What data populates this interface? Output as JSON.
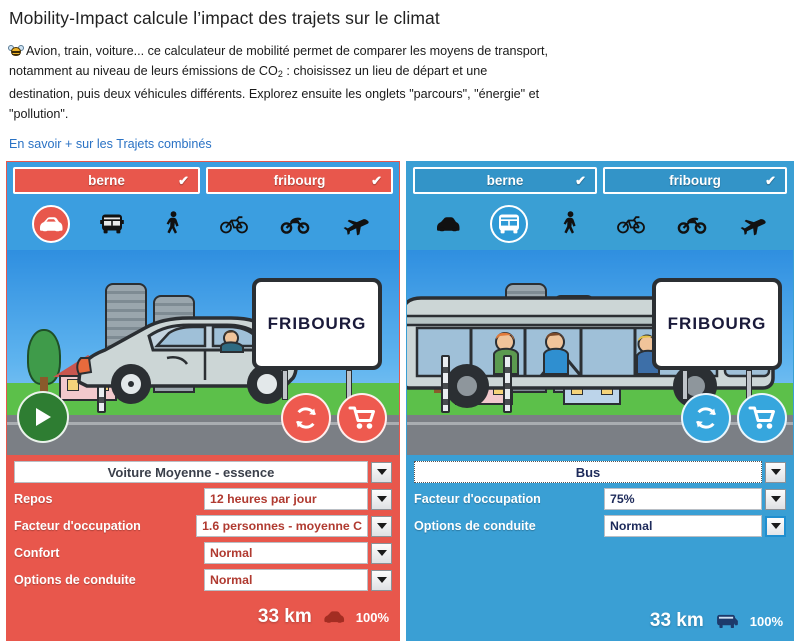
{
  "header": {
    "title": "Mobility-Impact calcule l’impact des trajets sur le climat",
    "bee_icon": "bee-icon",
    "intro_part1": "Avion, train, voiture... ce calculateur de mobilité permet de comparer les moyens de transport, notamment au niveau de leurs émissions de CO",
    "intro_sub": "2",
    "intro_part2": " : choisissez un lieu de départ et une destination, puis deux véhicules différents. Explorez ensuite les onglets \"parcours\", \"énergie\" et \"pollution\".",
    "link": "En savoir + sur les Trajets combinés"
  },
  "colors": {
    "red_accent": "#e8574c",
    "blue_accent": "#3a9fd4",
    "sky_blue": "#3b9ee0",
    "play_green": "#2e7d32",
    "link_blue": "#2a72c4"
  },
  "modes": [
    {
      "name": "car",
      "icon": "car-icon"
    },
    {
      "name": "bus",
      "icon": "bus-icon"
    },
    {
      "name": "pedestrian",
      "icon": "pedestrian-icon"
    },
    {
      "name": "bicycle",
      "icon": "bicycle-icon"
    },
    {
      "name": "motorcycle",
      "icon": "motorcycle-icon"
    },
    {
      "name": "airplane",
      "icon": "airplane-icon"
    }
  ],
  "left": {
    "origin": "berne",
    "destination": "fribourg",
    "origin_check": "✔",
    "destination_check": "✔",
    "selected_mode": "car",
    "sign_label": "FRIBOURG",
    "play_icon": "play-icon",
    "refresh_icon": "refresh-icon",
    "cart_icon": "cart-icon",
    "vehicle": "Voiture Moyenne - essence",
    "fields": [
      {
        "label": "Repos",
        "value": "12 heures par jour"
      },
      {
        "label": "Facteur d'occupation",
        "value": "1.6 personnes - moyenne C"
      },
      {
        "label": "Confort",
        "value": "Normal"
      },
      {
        "label": "Options de conduite",
        "value": "Normal"
      }
    ],
    "distance": "33 km",
    "share": "100%",
    "share_icon": "car-icon"
  },
  "right": {
    "origin": "berne",
    "destination": "fribourg",
    "origin_check": "✔",
    "destination_check": "✔",
    "selected_mode": "bus",
    "sign_label": "FRIBOURG",
    "refresh_icon": "refresh-icon",
    "cart_icon": "cart-icon",
    "vehicle": "Bus",
    "fields": [
      {
        "label": "Facteur d'occupation",
        "value": "75%"
      },
      {
        "label": "Options de conduite",
        "value": "Normal"
      }
    ],
    "distance": "33 km",
    "share": "100%",
    "share_icon": "bus-icon"
  }
}
